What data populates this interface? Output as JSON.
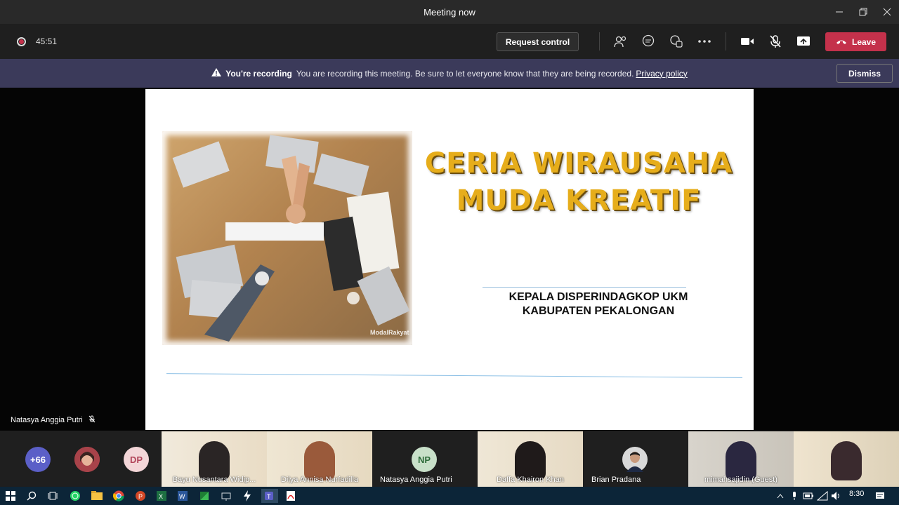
{
  "window": {
    "title": "Meeting now"
  },
  "toolbar": {
    "timer": "45:51",
    "request_control": "Request control",
    "leave": "Leave"
  },
  "banner": {
    "title": "You're recording",
    "message": "You are recording this meeting. Be sure to let everyone know that they are being recorded.",
    "link": "Privacy policy",
    "dismiss": "Dismiss"
  },
  "slide": {
    "title_line1": "CERIA WIRAUSAHA",
    "title_line2": "MUDA KREATIF",
    "subtitle_line1": "KEPALA DISPERINDAGKOP UKM",
    "subtitle_line2": "KABUPATEN PEKALONGAN",
    "watermark": "ModalRakyat"
  },
  "stage": {
    "speaker": "Natasya Anggia Putri"
  },
  "participants": {
    "overflow": "+66",
    "dp_initials": "DP",
    "np_initials": "NP",
    "tiles": [
      {
        "name": "Bayu Nusantara Widip..."
      },
      {
        "name": "Dilya Annisa Nurfadilla"
      },
      {
        "name": "Natasya Anggia Putri"
      },
      {
        "name": "Daffa Khairon Khan"
      },
      {
        "name": "Brian Pradana"
      },
      {
        "name": "mimahsajidin (Guest)"
      }
    ]
  },
  "taskbar": {
    "time": "8:30"
  },
  "colors": {
    "leave": "#c4314b",
    "banner": "#3b3a5a",
    "title_gold": "#e6ad1b"
  }
}
